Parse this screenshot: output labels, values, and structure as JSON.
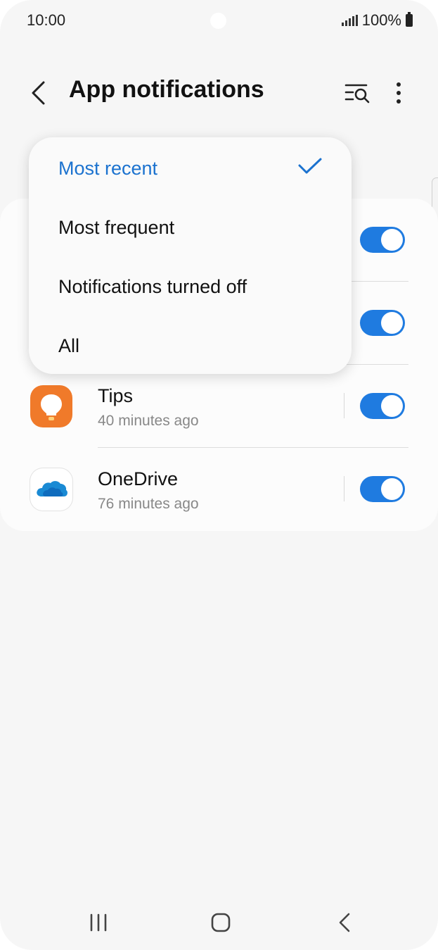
{
  "status_bar": {
    "time": "10:00",
    "battery": "100%"
  },
  "header": {
    "title": "App notifications"
  },
  "sort_menu": {
    "options": [
      {
        "label": "Most recent",
        "selected": true
      },
      {
        "label": "Most frequent",
        "selected": false
      },
      {
        "label": "Notifications turned off",
        "selected": false
      },
      {
        "label": "All",
        "selected": false
      }
    ]
  },
  "apps": [
    {
      "name": "Tips",
      "last_time": "40 minutes ago",
      "enabled": true,
      "icon": "tips-lightbulb-icon"
    },
    {
      "name": "OneDrive",
      "last_time": "76 minutes ago",
      "enabled": true,
      "icon": "onedrive-cloud-icon"
    }
  ],
  "hidden_rows": [
    {
      "enabled": true
    },
    {
      "enabled": true
    }
  ],
  "colors": {
    "accent": "#1f7be0",
    "selected_text": "#1b72cf",
    "tips_orange": "#f07a2a"
  }
}
